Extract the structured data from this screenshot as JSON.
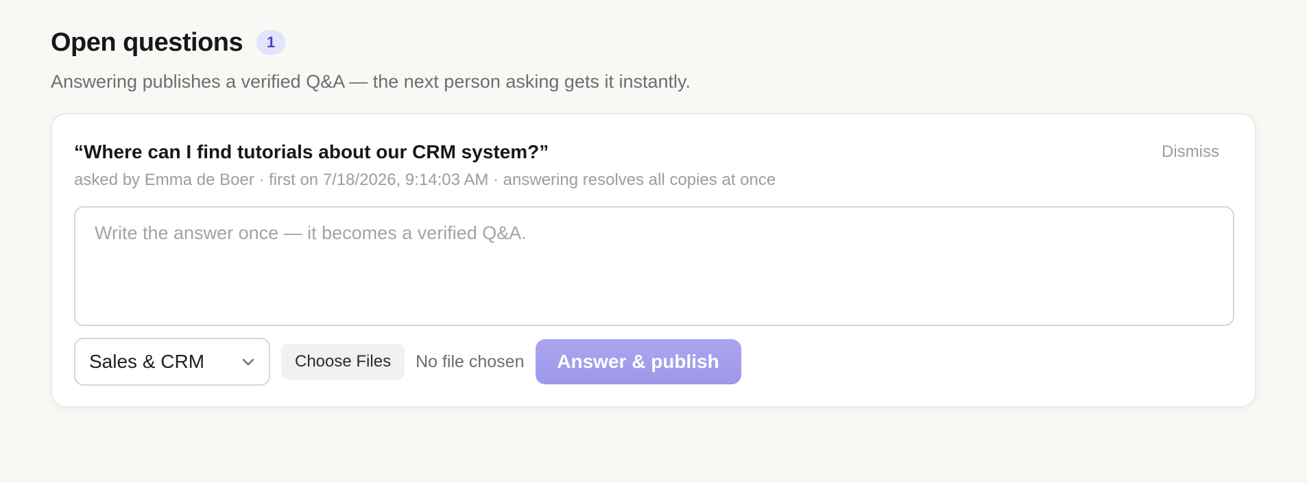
{
  "header": {
    "title": "Open questions",
    "count": "1",
    "subtitle": "Answering publishes a verified Q&A — the next person asking gets it instantly."
  },
  "question_card": {
    "question": "“Where can I find tutorials about our CRM system?”",
    "dismiss_label": "Dismiss",
    "meta": "asked by Emma de Boer · first on 7/18/2026, 9:14:03 AM · answering resolves all copies at once",
    "answer_placeholder": "Write the answer once — it becomes a verified Q&A.",
    "answer_value": "",
    "category_selected": "Sales & CRM",
    "choose_files_label": "Choose Files",
    "no_file_text": "No file chosen",
    "publish_label": "Answer & publish"
  },
  "colors": {
    "accent": "#9d98e8",
    "badge_bg": "#e3e4fb",
    "badge_text": "#4a46b8",
    "page_bg": "#f9f8f5"
  },
  "icons": {
    "select_chevron": "chevron-down-icon"
  }
}
